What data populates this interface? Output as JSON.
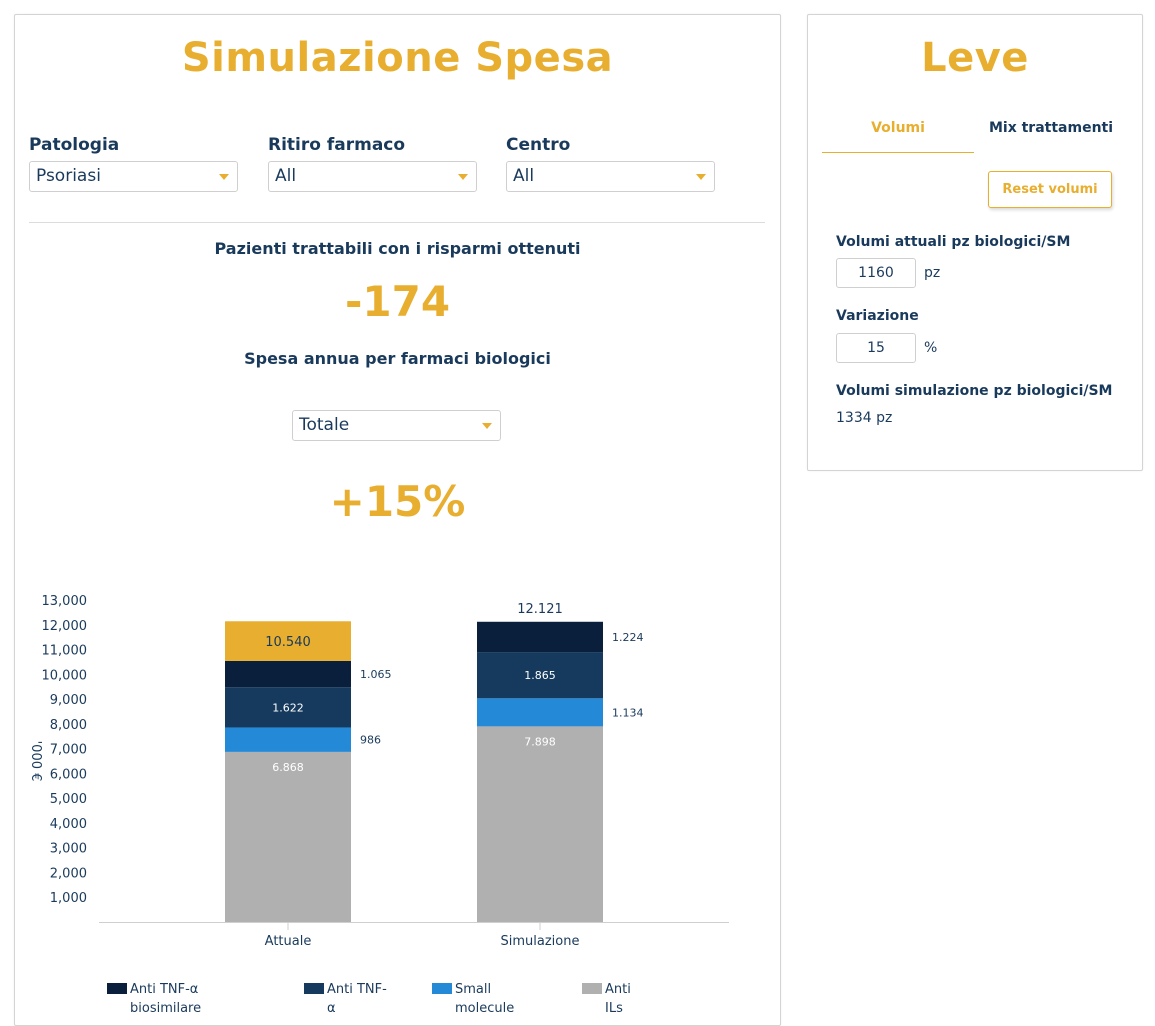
{
  "left": {
    "title": "Simulazione Spesa",
    "filters": [
      {
        "label": "Patologia",
        "value": "Psoriasi"
      },
      {
        "label": "Ritiro farmaco",
        "value": "All"
      },
      {
        "label": "Centro",
        "value": "All"
      }
    ],
    "patients_heading": "Pazienti trattabili con i risparmi ottenuti",
    "patients_value": "-174",
    "spend_heading": "Spesa annua per farmaci biologici",
    "spend_select": "Totale",
    "spend_change": "+15%"
  },
  "right": {
    "title": "Leve",
    "tabs": [
      {
        "label": "Volumi",
        "active": true
      },
      {
        "label": "Mix trattamenti",
        "active": false
      }
    ],
    "reset_label": "Reset volumi",
    "current_volume_label": "Volumi attuali pz biologici/SM",
    "current_volume_value": "1160",
    "current_volume_unit": "pz",
    "variation_label": "Variazione",
    "variation_value": "15",
    "variation_unit": "%",
    "sim_volume_label": "Volumi simulazione pz biologici/SM",
    "sim_volume_value": "1334 pz"
  },
  "chart_data": {
    "type": "bar",
    "stacked": true,
    "ylabel": "'000 €",
    "ylim": [
      0,
      13000
    ],
    "yticks": [
      "1,000",
      "2,000",
      "3,000",
      "4,000",
      "5,000",
      "6,000",
      "7,000",
      "8,000",
      "9,000",
      "10,000",
      "11,000",
      "12,000",
      "13,000"
    ],
    "categories": [
      "Attuale",
      "Simulazione"
    ],
    "series": [
      {
        "name": "Anti ILs",
        "color": "#b0b0b0",
        "values": [
          6868,
          7898
        ],
        "labels": [
          "6.868",
          "7.898"
        ]
      },
      {
        "name": "Small molecule",
        "color": "#2489d6",
        "values": [
          986,
          1134
        ],
        "labels": [
          "986",
          "1.134"
        ]
      },
      {
        "name": "Anti TNF-α",
        "color": "#163a5e",
        "values": [
          1622,
          1865
        ],
        "labels": [
          "1.622",
          "1.865"
        ]
      },
      {
        "name": "Anti TNF-α biosimilare",
        "color": "#0a1f3c",
        "values": [
          1065,
          1224
        ],
        "labels": [
          "1.065",
          "1.224"
        ]
      }
    ],
    "totals": [
      "10.540",
      "12.121"
    ],
    "total_colors": [
      "#e8ae2f",
      null
    ],
    "legend": [
      "Anti TNF-α biosimilare",
      "Anti TNF-α",
      "Small molecule",
      "Anti ILs"
    ],
    "legend_position": "bottom"
  }
}
